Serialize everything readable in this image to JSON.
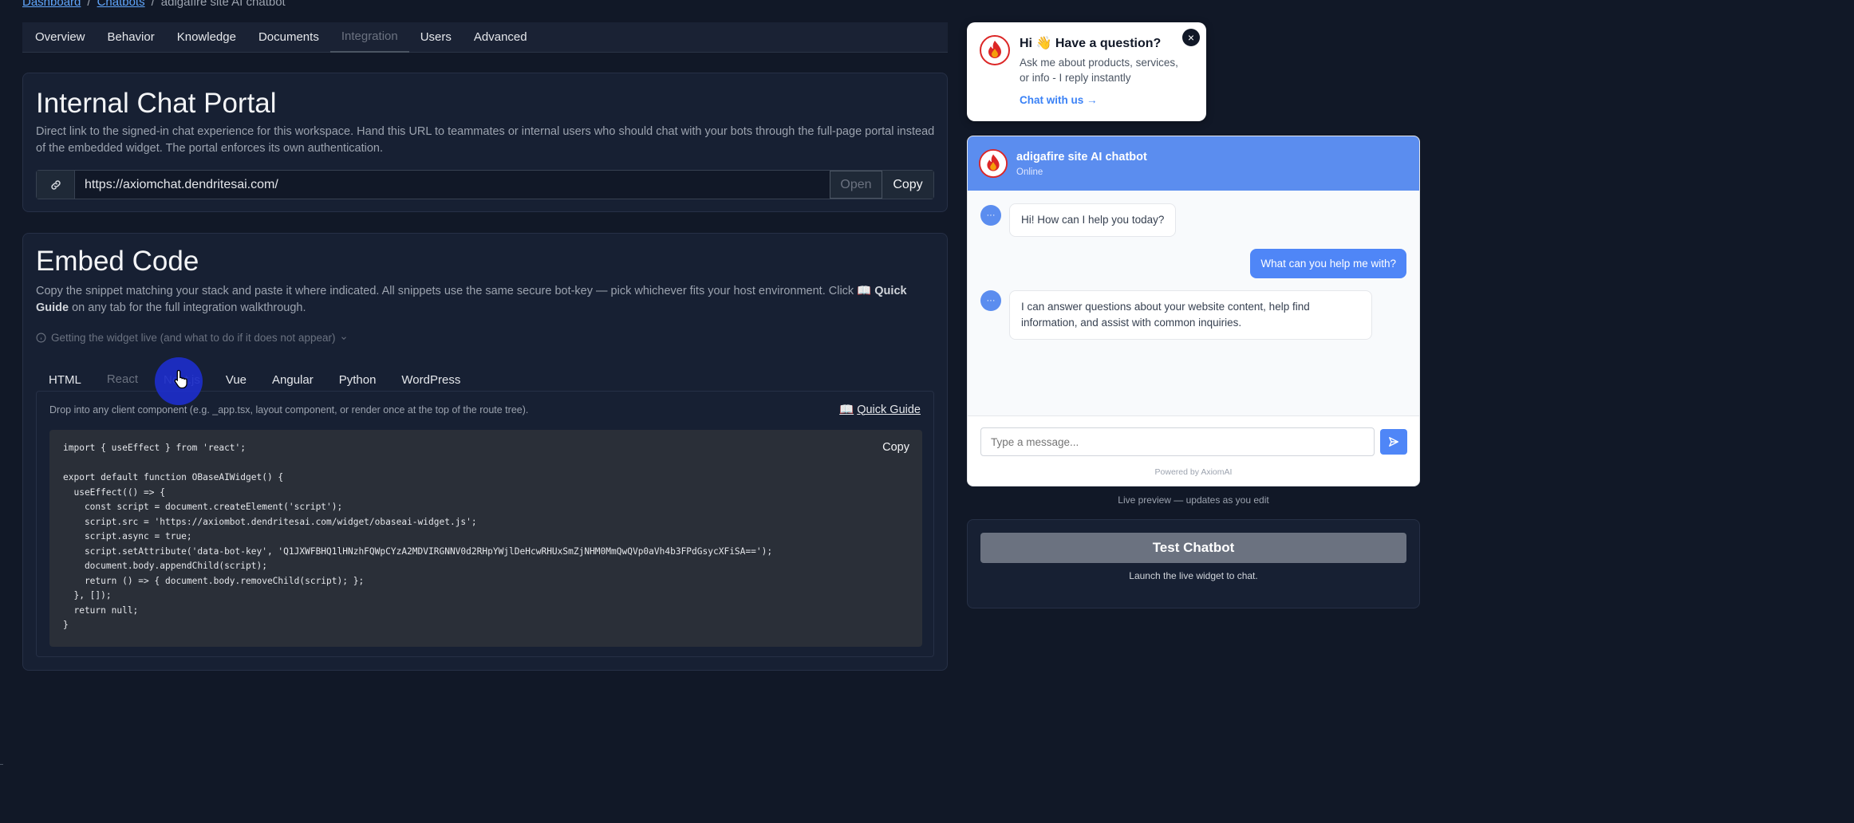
{
  "breadcrumb": {
    "items": [
      "Dashboard",
      "Chatbots",
      "adigafire site AI chatbot"
    ],
    "separator": "/"
  },
  "top_tabs": [
    "Overview",
    "Behavior",
    "Knowledge",
    "Documents",
    "Integration",
    "Users",
    "Advanced"
  ],
  "top_tabs_active": "Integration",
  "portal": {
    "title": "Internal Chat Portal",
    "description": "Direct link to the signed-in chat experience for this workspace. Hand this URL to teammates or internal users who should chat with your bots through the full-page portal instead of the embedded widget. The portal enforces its own authentication.",
    "url": "https://axiomchat.dendritesai.com/",
    "open_label": "Open",
    "copy_label": "Copy"
  },
  "embed": {
    "title": "Embed Code",
    "description_pre": "Copy the snippet matching your stack and paste it where indicated. All snippets use the same secure bot-key — pick whichever fits your host environment. Click 📖 ",
    "description_bold": "Quick Guide",
    "description_post": " on any tab for the full integration walkthrough.",
    "getting_live": "Getting the widget live (and what to do if it does not appear)",
    "code_tabs": [
      "HTML",
      "React",
      "Next.js",
      "Vue",
      "Angular",
      "Python",
      "WordPress"
    ],
    "active_code_tab": "React",
    "hint": "Drop into any client component (e.g. _app.tsx, layout component, or render once at the top of the route tree).",
    "quick_guide": "Quick Guide",
    "copy_label": "Copy",
    "code": "import { useEffect } from 'react';\n\nexport default function OBaseAIWidget() {\n  useEffect(() => {\n    const script = document.createElement('script');\n    script.src = 'https://axiombot.dendritesai.com/widget/obaseai-widget.js';\n    script.async = true;\n    script.setAttribute('data-bot-key', 'Q1JXWFBHQ1lHNzhFQWpCYzA2MDVIRGNNV0d2RHpYWjlDeHcwRHUxSmZjNHM0MmQwQVp0aVh4b3FPdGsycXFiSA==');\n    document.body.appendChild(script);\n    return () => { document.body.removeChild(script); };\n  }, []);\n  return null;\n}"
  },
  "popup": {
    "title": "Hi 👋 Have a question?",
    "body": "Ask me about products, services, or info - I reply instantly",
    "cta": "Chat with us →"
  },
  "widget": {
    "title": "adigafire site AI chatbot",
    "status": "Online",
    "messages": [
      {
        "from": "bot",
        "text": "Hi! How can I help you today?"
      },
      {
        "from": "user",
        "text": "What can you help me with?"
      },
      {
        "from": "bot",
        "text": "I can answer questions about your website content, help find information, and assist with common inquiries."
      }
    ],
    "input_placeholder": "Type a message...",
    "powered_by": "Powered by AxiomAI"
  },
  "live_preview": "Live preview — updates as you edit",
  "test": {
    "button": "Test Chatbot",
    "subtitle": "Launch the live widget to chat."
  },
  "colors": {
    "background": "#111827",
    "widget_header": "#5b8def",
    "user_bubble": "#4f86f7",
    "link": "#60a5fa"
  }
}
